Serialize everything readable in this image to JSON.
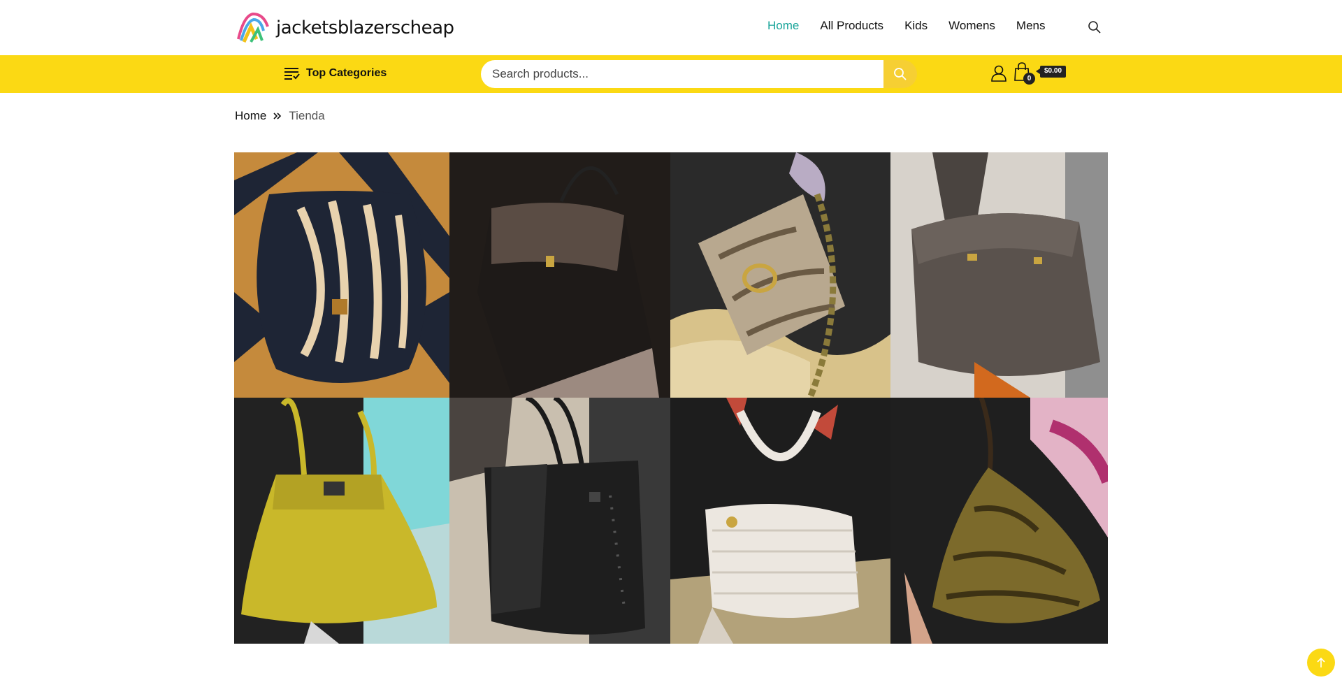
{
  "site": {
    "logo_text": "jacketsblazerscheap",
    "accent": "#1aa59a",
    "bar_color": "#fbd914"
  },
  "nav": {
    "items": [
      {
        "label": "Home",
        "active": true
      },
      {
        "label": "All Products",
        "active": false
      },
      {
        "label": "Kids",
        "active": false
      },
      {
        "label": "Womens",
        "active": false
      },
      {
        "label": "Mens",
        "active": false
      }
    ]
  },
  "toolbar": {
    "categories_label": "Top Categories",
    "search_placeholder": "Search products...",
    "cart_count": "0",
    "cart_total": "$0.00"
  },
  "breadcrumb": {
    "home": "Home",
    "current": "Tienda"
  },
  "hero": {
    "tiles": [
      {
        "icon": "woven-bag",
        "colors": [
          "#c58a3c",
          "#1e2535",
          "#e8d2ae"
        ]
      },
      {
        "icon": "leather-shoulder-bag",
        "colors": [
          "#3a2a22",
          "#141414",
          "#9c8a80"
        ]
      },
      {
        "icon": "python-bag",
        "colors": [
          "#b8a88f",
          "#d8c28a",
          "#2a2a2a"
        ]
      },
      {
        "icon": "grey-tote",
        "colors": [
          "#5a524d",
          "#8f8f8f",
          "#d7d2cb"
        ]
      },
      {
        "icon": "yellow-bag",
        "colors": [
          "#c9b82a",
          "#80d7d8",
          "#222222"
        ]
      },
      {
        "icon": "black-tote",
        "colors": [
          "#1e1e1e",
          "#c9bfaf",
          "#393939"
        ]
      },
      {
        "icon": "white-woven-bag",
        "colors": [
          "#ece7e0",
          "#1d1d1d",
          "#b3a27a"
        ]
      },
      {
        "icon": "snakeskin-hobo",
        "colors": [
          "#7c6a2b",
          "#e3b3c6",
          "#1f1f1f"
        ]
      }
    ]
  }
}
